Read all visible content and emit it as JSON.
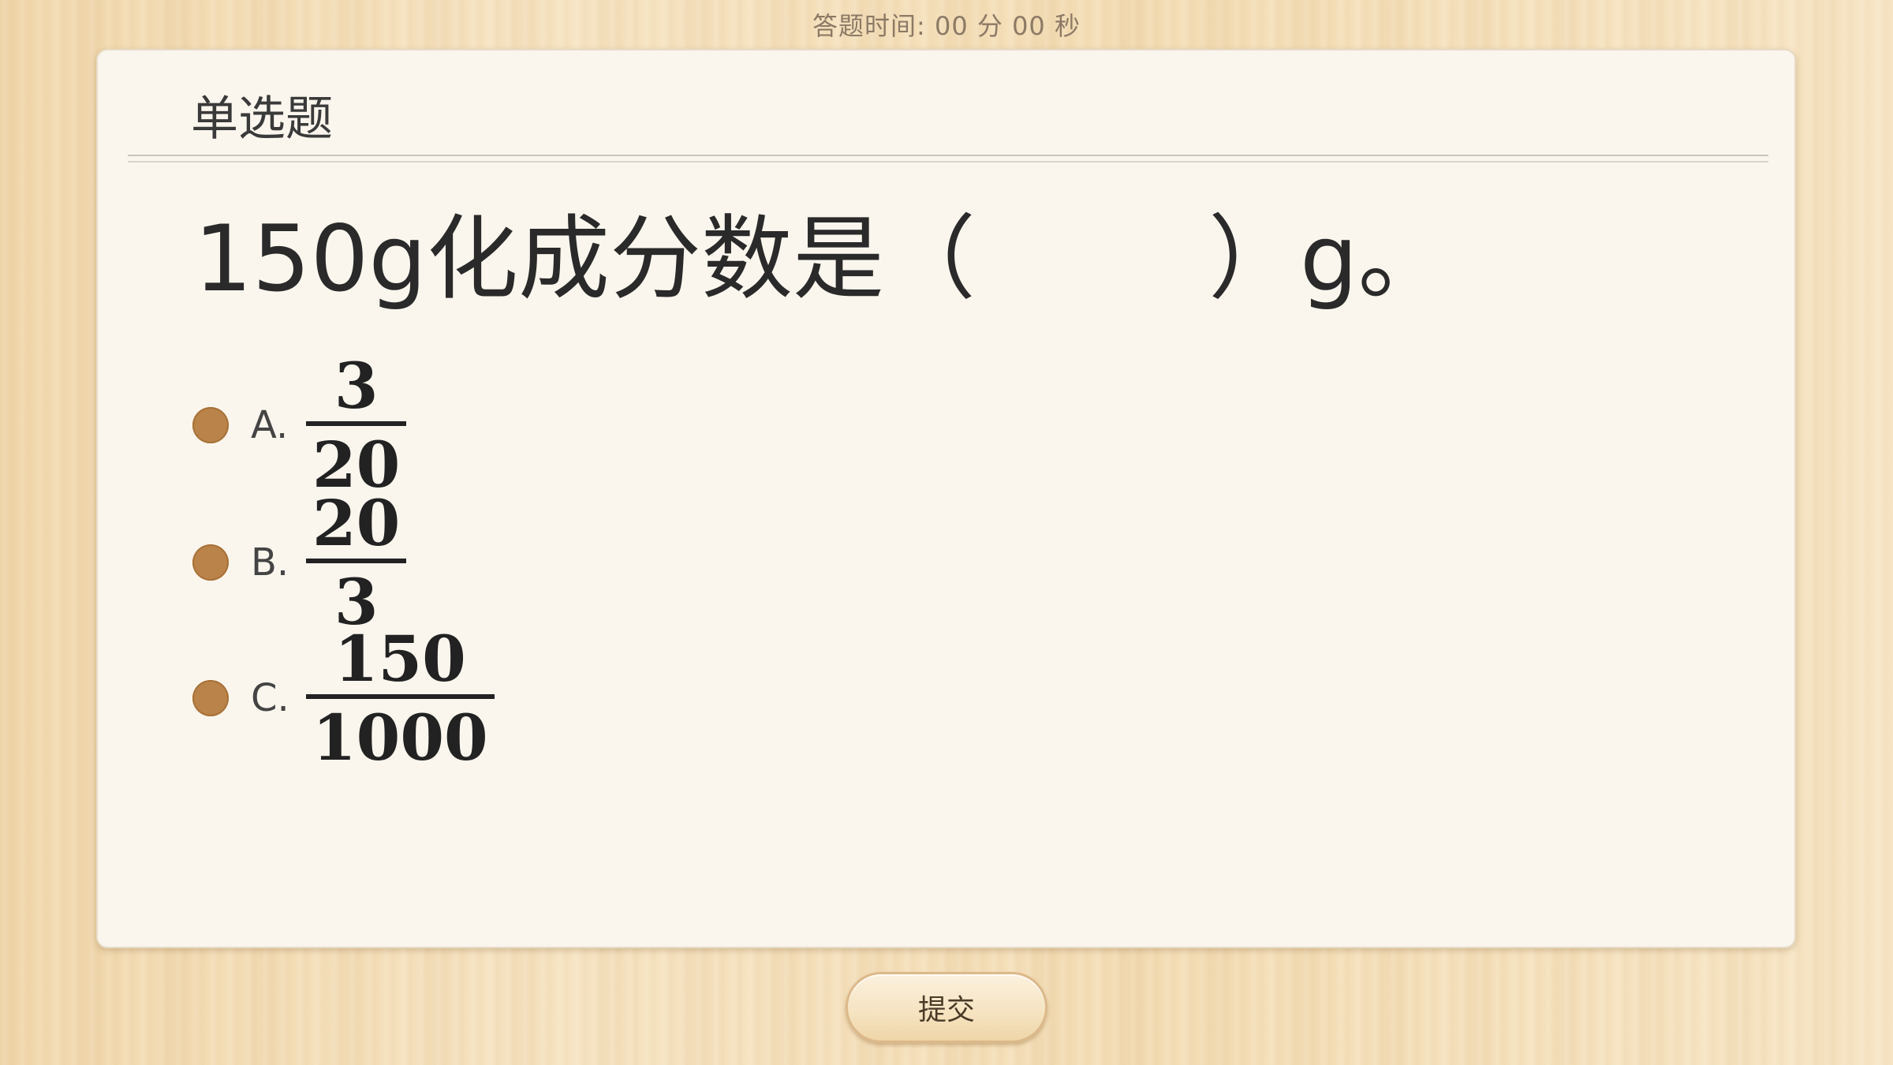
{
  "timer": {
    "label": "答题时间:",
    "value": "00 分 00 秒"
  },
  "card": {
    "title": "单选题",
    "question": "150g化成分数是（        ）g。"
  },
  "options": [
    {
      "letter": "A.",
      "numerator": "3",
      "denominator": "20"
    },
    {
      "letter": "B.",
      "numerator": "20",
      "denominator": "3"
    },
    {
      "letter": "C.",
      "numerator": "150",
      "denominator": "1000"
    }
  ],
  "submit": {
    "label": "提交"
  },
  "colors": {
    "radio": "#b98349",
    "card_bg": "#faf6ee",
    "wood_bg": "#f3dcb3"
  }
}
